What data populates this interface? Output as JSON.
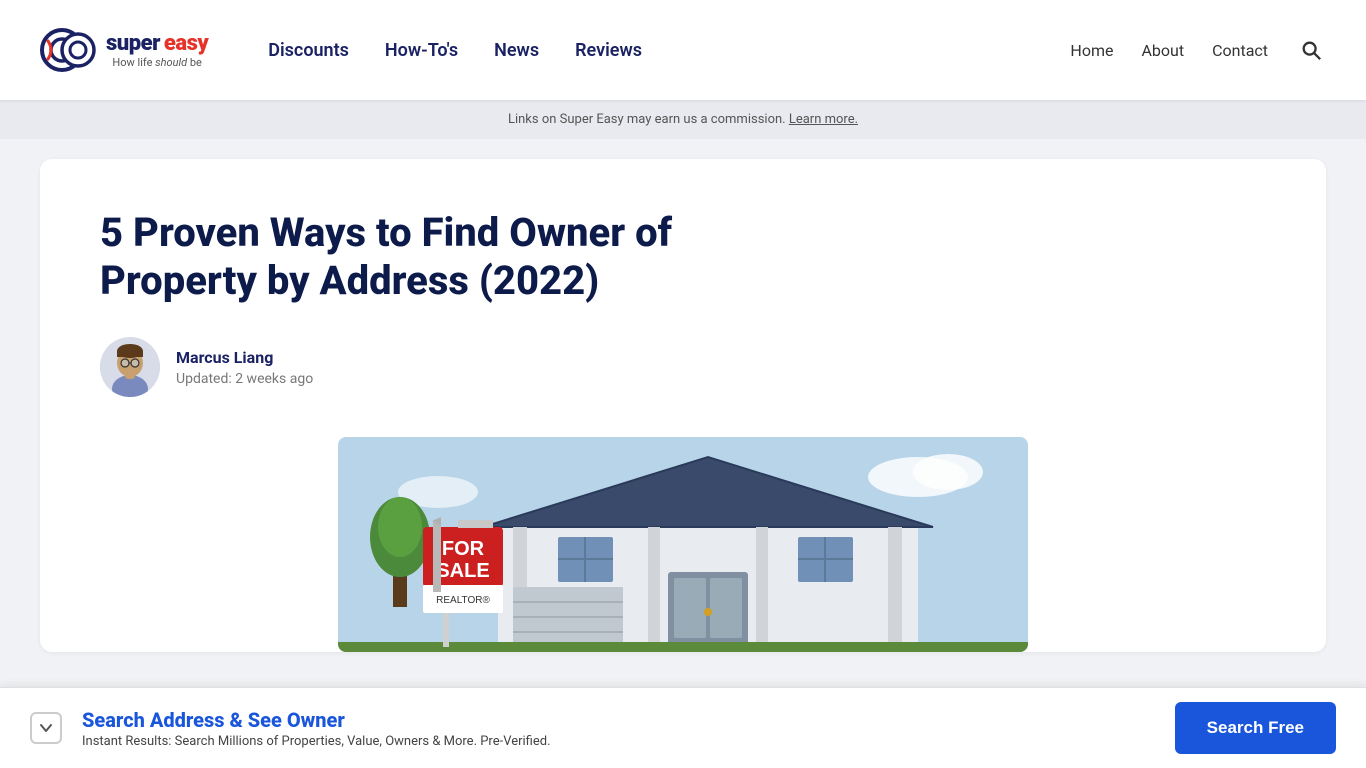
{
  "header": {
    "logo": {
      "brand_top": "super",
      "brand_bottom": "easy",
      "tagline_prefix": "How life ",
      "tagline_highlight": "should",
      "tagline_suffix": " be"
    },
    "nav_main": [
      {
        "label": "Discounts",
        "href": "#"
      },
      {
        "label": "How-To's",
        "href": "#"
      },
      {
        "label": "News",
        "href": "#"
      },
      {
        "label": "Reviews",
        "href": "#"
      }
    ],
    "nav_secondary": [
      {
        "label": "Home",
        "href": "#"
      },
      {
        "label": "About",
        "href": "#"
      },
      {
        "label": "Contact",
        "href": "#"
      }
    ],
    "search_label": "Search"
  },
  "affiliate_banner": {
    "text": "Links on Super Easy may earn us a commission.",
    "link_text": "Learn more."
  },
  "article": {
    "title": "5 Proven Ways to Find Owner of Property by Address (2022)",
    "author_name": "Marcus Liang",
    "updated_text": "Updated: 2 weeks ago",
    "image_alt": "House with For Sale sign"
  },
  "sticky_bar": {
    "title": "Search Address & See Owner",
    "subtitle": "Instant Results: Search Millions of Properties, Value, Owners & More. Pre-Verified.",
    "button_label": "Search Free"
  }
}
